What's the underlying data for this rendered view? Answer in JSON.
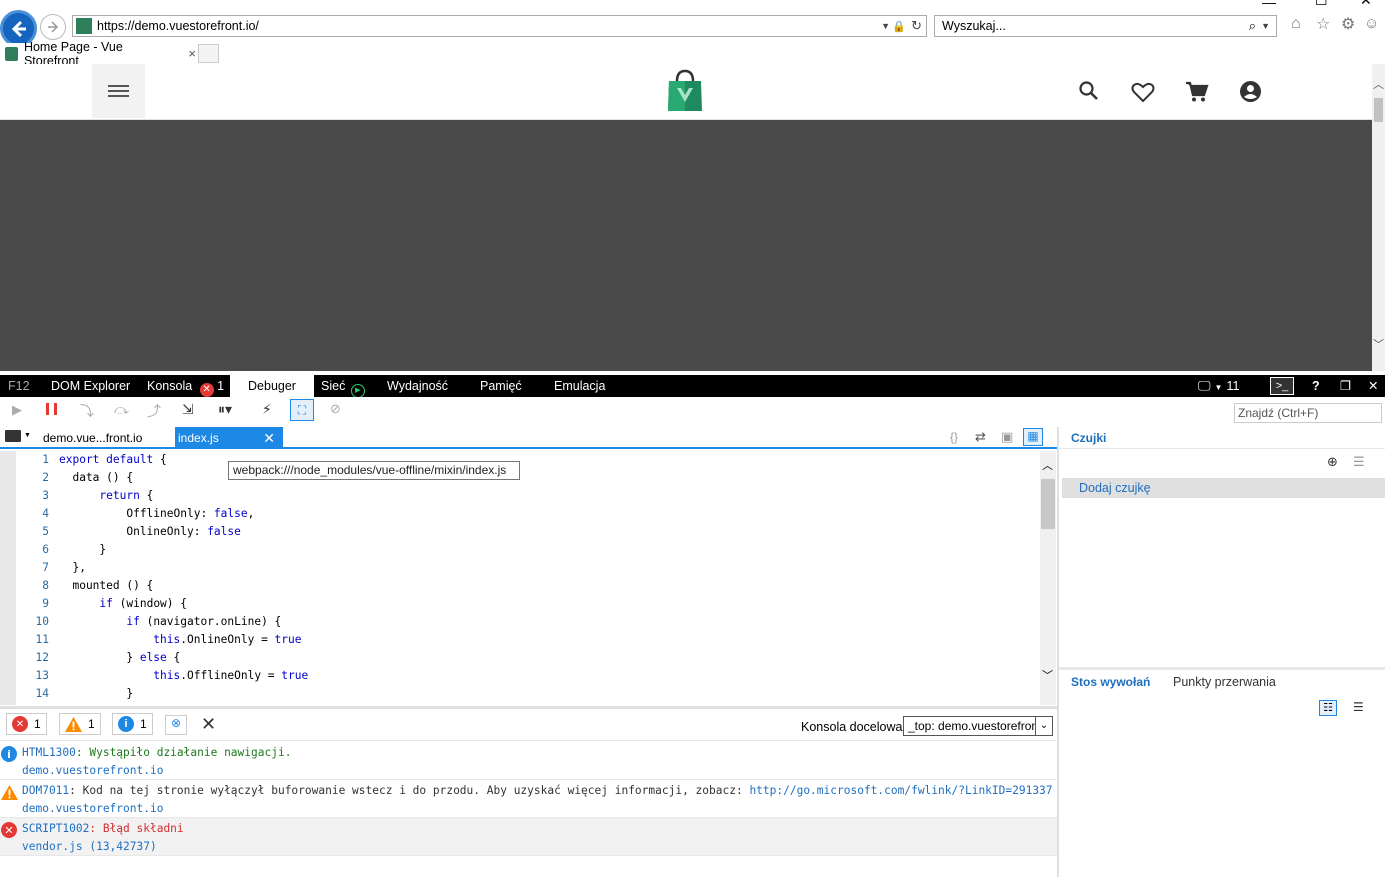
{
  "browser": {
    "url_prefix": "https://",
    "url_host": "demo.vuestorefront.io/",
    "search_placeholder": "Wyszukaj...",
    "tab_title": "Home Page - Vue Storefront",
    "tab_close": "×"
  },
  "devtools": {
    "tabs": {
      "f12": "F12",
      "dom": "DOM Explorer",
      "console": "Konsola",
      "console_errors": "1",
      "debugger": "Debuger",
      "network": "Sieć",
      "performance": "Wydajność",
      "memory": "Pamięć",
      "emulation": "Emulacja"
    },
    "doc_mode": "11",
    "find_placeholder": "Znajdź (Ctrl+F)",
    "file_tabs": [
      "demo.vue...front.io",
      "index.js"
    ],
    "tooltip": "webpack:///node_modules/vue-offline/mixin/index.js",
    "code_lines": [
      {
        "n": "1",
        "segments": [
          {
            "t": "export default",
            "k": true
          },
          {
            "t": " {",
            "k": false
          }
        ]
      },
      {
        "n": "2",
        "segments": [
          {
            "t": "  data () {",
            "k": false
          }
        ]
      },
      {
        "n": "3",
        "segments": [
          {
            "t": "      ",
            "k": false
          },
          {
            "t": "return",
            "k": true
          },
          {
            "t": " {",
            "k": false
          }
        ]
      },
      {
        "n": "4",
        "segments": [
          {
            "t": "          OfflineOnly: ",
            "k": false
          },
          {
            "t": "false",
            "k": true
          },
          {
            "t": ",",
            "k": false
          }
        ]
      },
      {
        "n": "5",
        "segments": [
          {
            "t": "          OnlineOnly: ",
            "k": false
          },
          {
            "t": "false",
            "k": true
          }
        ]
      },
      {
        "n": "6",
        "segments": [
          {
            "t": "      }",
            "k": false
          }
        ]
      },
      {
        "n": "7",
        "segments": [
          {
            "t": "  },",
            "k": false
          }
        ]
      },
      {
        "n": "8",
        "segments": [
          {
            "t": "  mounted () {",
            "k": false
          }
        ]
      },
      {
        "n": "9",
        "segments": [
          {
            "t": "      ",
            "k": false
          },
          {
            "t": "if",
            "k": true
          },
          {
            "t": " (window) {",
            "k": false
          }
        ]
      },
      {
        "n": "10",
        "segments": [
          {
            "t": "          ",
            "k": false
          },
          {
            "t": "if",
            "k": true
          },
          {
            "t": " (navigator.onLine) {",
            "k": false
          }
        ]
      },
      {
        "n": "11",
        "segments": [
          {
            "t": "              ",
            "k": false
          },
          {
            "t": "this",
            "k": true
          },
          {
            "t": ".OnlineOnly = ",
            "k": false
          },
          {
            "t": "true",
            "k": true
          }
        ]
      },
      {
        "n": "12",
        "segments": [
          {
            "t": "          } ",
            "k": false
          },
          {
            "t": "else",
            "k": true
          },
          {
            "t": " {",
            "k": false
          }
        ]
      },
      {
        "n": "13",
        "segments": [
          {
            "t": "              ",
            "k": false
          },
          {
            "t": "this",
            "k": true
          },
          {
            "t": ".OfflineOnly = ",
            "k": false
          },
          {
            "t": "true",
            "k": true
          }
        ]
      },
      {
        "n": "14",
        "segments": [
          {
            "t": "          }",
            "k": false
          }
        ]
      }
    ],
    "watches": {
      "title": "Czujki",
      "add": "Dodaj czujkę"
    },
    "callstack_tab": "Stos wywołań",
    "breakpoints_tab": "Punkty przerwania",
    "console": {
      "error_count": "1",
      "warning_count": "1",
      "info_count": "1",
      "target_label": "Konsola docelowa",
      "target_value": "_top: demo.vuestorefront.io",
      "messages": [
        {
          "type": "info",
          "code": "HTML1300",
          "text": ": Wystąpiło działanie nawigacji.",
          "link": "",
          "source": "demo.vuestorefront.io",
          "color": "#1e7a1e"
        },
        {
          "type": "warning",
          "code": "DOM7011",
          "text": ": Kod na tej stronie wyłączył buforowanie wstecz i do przodu. Aby uzyskać więcej informacji, zobacz: ",
          "link": "http://go.microsoft.com/fwlink/?LinkID=291337",
          "source": "demo.vuestorefront.io",
          "color": "#333333"
        },
        {
          "type": "error",
          "code": "SCRIPT1002",
          "text": ": Błąd składni",
          "link": "",
          "source": "vendor.js (13,42737)",
          "color": "#d32f2f"
        }
      ]
    }
  },
  "colors": {
    "accent": "#1e88e5",
    "error": "#e53935",
    "warning": "#fb8c00",
    "info": "#1e88e5"
  }
}
